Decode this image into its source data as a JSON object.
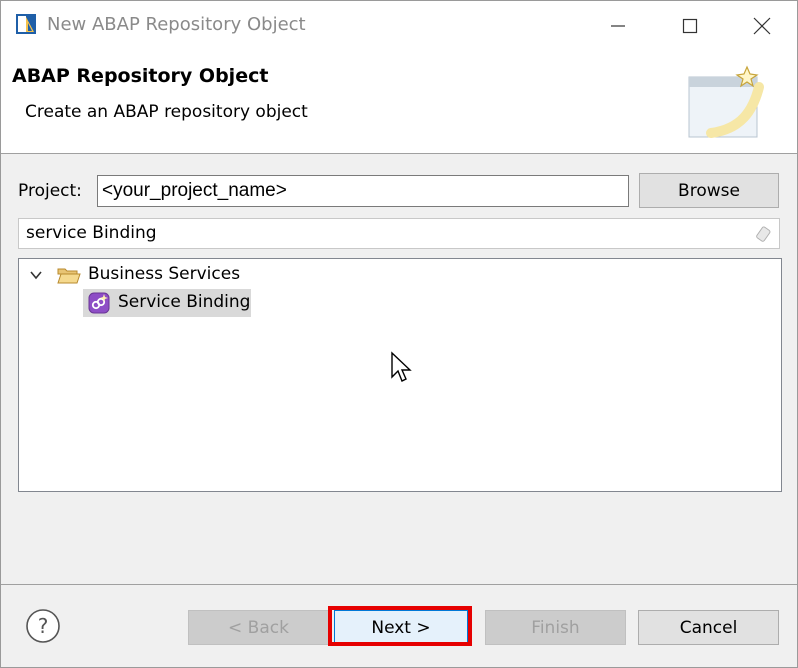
{
  "window": {
    "title": "New ABAP Repository Object",
    "controls": {
      "minimize_icon": "minimize-icon",
      "maximize_icon": "maximize-icon",
      "close_icon": "close-icon"
    }
  },
  "header": {
    "title": "ABAP Repository Object",
    "description": "Create an ABAP repository object"
  },
  "project": {
    "label": "Project:",
    "value": "<your_project_name>",
    "browse_label": "Browse"
  },
  "filter": {
    "value": "service Binding"
  },
  "tree": {
    "folder": {
      "label": "Business Services",
      "expanded": true
    },
    "items": [
      {
        "label": "Service Binding",
        "selected": true
      }
    ]
  },
  "footer": {
    "back_label": "< Back",
    "next_label": "Next >",
    "finish_label": "Finish",
    "cancel_label": "Cancel"
  },
  "colors": {
    "highlight": "#e60000",
    "selection": "#d9d9d9",
    "service_binding_icon": "#8e4ec6"
  }
}
